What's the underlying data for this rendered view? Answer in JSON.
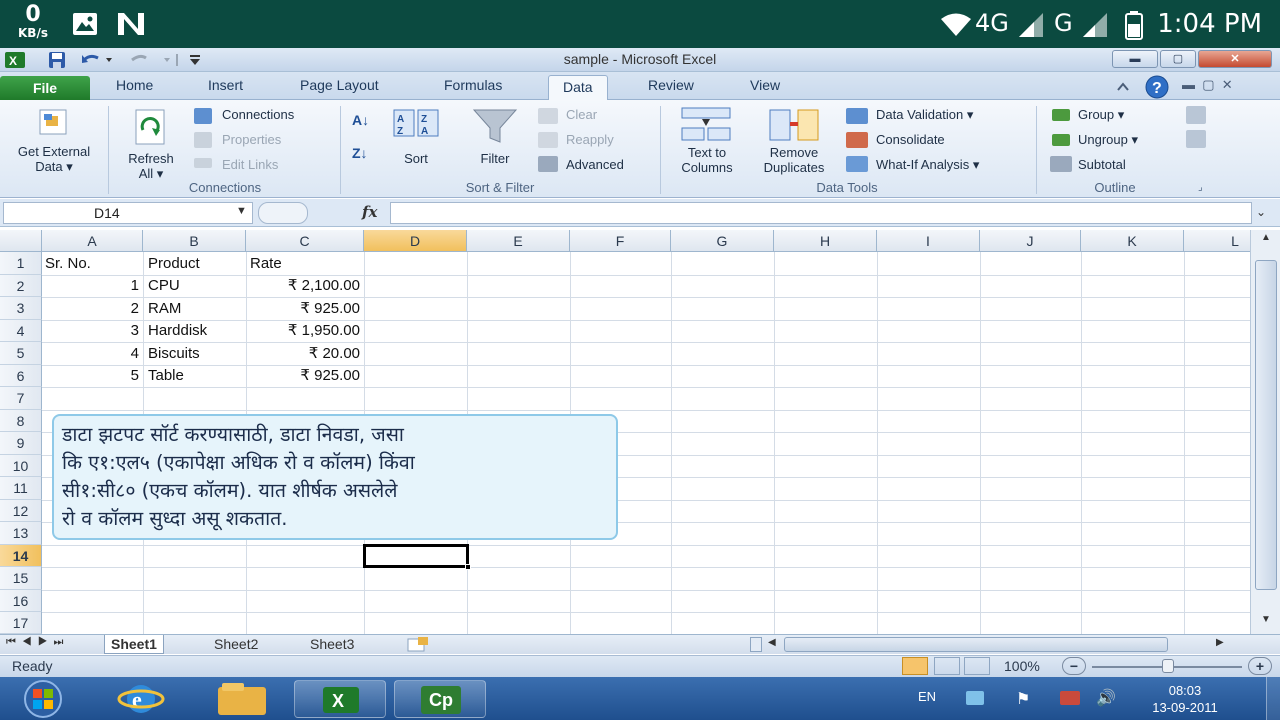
{
  "android": {
    "kbs_value": "0",
    "kbs_unit": "KB/s",
    "network_4g": "4G",
    "network_g": "G",
    "time": "1:04 PM"
  },
  "window": {
    "title": "sample - Microsoft Excel"
  },
  "ribbon_tabs": [
    "File",
    "Home",
    "Insert",
    "Page Layout",
    "Formulas",
    "Data",
    "Review",
    "View"
  ],
  "ribbon": {
    "get_external_data_1": "Get External",
    "get_external_data_2": "Data",
    "refresh_1": "Refresh",
    "refresh_2": "All",
    "connections": "Connections",
    "properties": "Properties",
    "edit_links": "Edit Links",
    "group_connections": "Connections",
    "sort": "Sort",
    "filter": "Filter",
    "clear": "Clear",
    "reapply": "Reapply",
    "advanced": "Advanced",
    "group_sort_filter": "Sort & Filter",
    "text_to_columns_1": "Text to",
    "text_to_columns_2": "Columns",
    "remove_duplicates_1": "Remove",
    "remove_duplicates_2": "Duplicates",
    "data_validation": "Data Validation",
    "consolidate": "Consolidate",
    "what_if": "What-If Analysis",
    "group_data_tools": "Data Tools",
    "group": "Group",
    "ungroup": "Ungroup",
    "subtotal": "Subtotal",
    "group_outline": "Outline"
  },
  "formula_bar": {
    "name_box": "D14",
    "fx": "fx",
    "formula": ""
  },
  "columns": [
    "A",
    "B",
    "C",
    "D",
    "E",
    "F",
    "G",
    "H",
    "I",
    "J",
    "K",
    "L"
  ],
  "rows": [
    "1",
    "2",
    "3",
    "4",
    "5",
    "6",
    "7",
    "8",
    "9",
    "10",
    "11",
    "12",
    "13",
    "14",
    "15",
    "16",
    "17"
  ],
  "table": {
    "headers": [
      "Sr. No.",
      "Product",
      "Rate"
    ],
    "rows": [
      {
        "sr": "1",
        "product": "CPU",
        "rate": "₹  2,100.00"
      },
      {
        "sr": "2",
        "product": "RAM",
        "rate": "₹  925.00"
      },
      {
        "sr": "3",
        "product": "Harddisk",
        "rate": "₹  1,950.00"
      },
      {
        "sr": "4",
        "product": "Biscuits",
        "rate": "₹  20.00"
      },
      {
        "sr": "5",
        "product": "Table",
        "rate": "₹  925.00"
      }
    ]
  },
  "callout": {
    "line1": "डाटा झटपट सॉर्ट करण्यासाठी, डाटा निवडा, जसा",
    "line2": "कि ए१:एल५ (एकापेक्षा अधिक रो व कॉलम) किंवा",
    "line3": "सी१:सी८० (एकच कॉलम). यात शीर्षक असलेले",
    "line4": "रो व कॉलम सुध्दा असू शकतात."
  },
  "sheets": [
    "Sheet1",
    "Sheet2",
    "Sheet3"
  ],
  "status": {
    "ready": "Ready",
    "zoom": "100%"
  },
  "taskbar": {
    "lang": "EN",
    "clock_time": "08:03",
    "clock_date": "13-09-2011",
    "captivate_label": "Cp"
  }
}
